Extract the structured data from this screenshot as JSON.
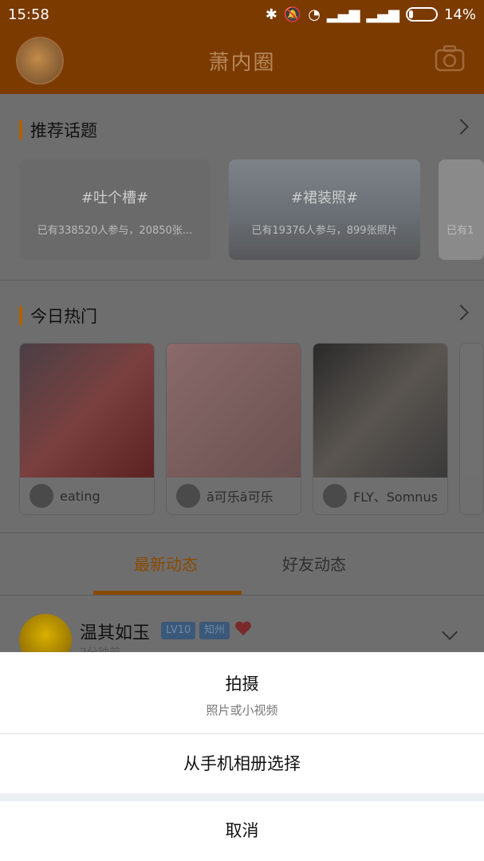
{
  "status_bar": {
    "time": "15:58",
    "battery": "14%"
  },
  "header": {
    "title": "萧内圈"
  },
  "sections": {
    "recommended": {
      "title": "推荐话题",
      "topics": [
        {
          "title": "#吐个槽#",
          "subtitle": "已有338520人参与，20850张..."
        },
        {
          "title": "#裙装照#",
          "subtitle": "已有19376人参与，899张照片"
        },
        {
          "title": "",
          "subtitle": "已有1"
        }
      ]
    },
    "hot": {
      "title": "今日热门",
      "items": [
        {
          "user": "eating"
        },
        {
          "user": "ā可乐ā可乐"
        },
        {
          "user": "FLY、Somnus"
        }
      ]
    }
  },
  "tabs": [
    {
      "label": "最新动态",
      "active": true
    },
    {
      "label": "好友动态",
      "active": false
    }
  ],
  "feed": {
    "user": "温其如玉",
    "level": "LV10",
    "location": "知州",
    "time": "2分钟前"
  },
  "sheet": {
    "capture_label": "拍摄",
    "capture_sub": "照片或小视频",
    "album_label": "从手机相册选择",
    "cancel_label": "取消"
  },
  "colors": {
    "header_bg": "#7a3a00",
    "accent": "#b36000",
    "overlay": "#6e6e6e"
  }
}
